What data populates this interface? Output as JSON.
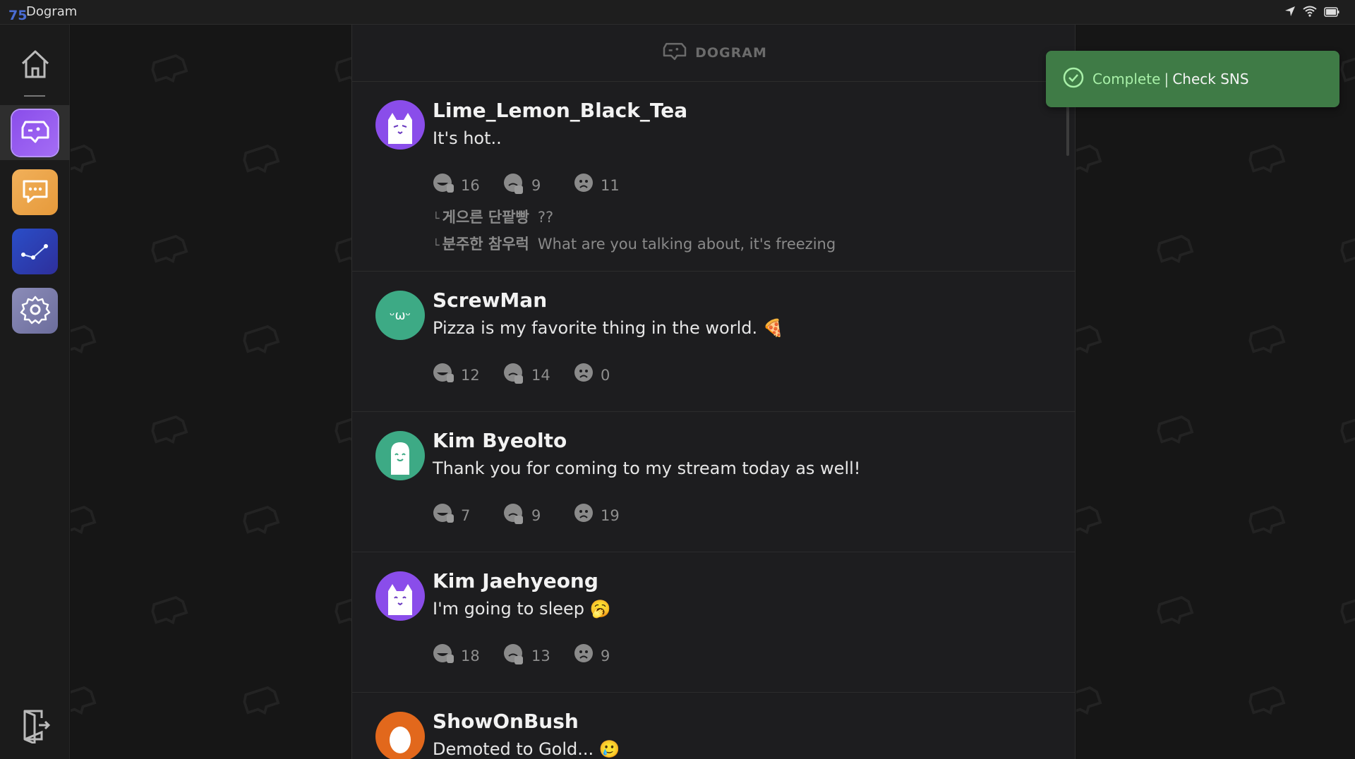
{
  "topbar": {
    "badge": "75",
    "app_title": "Dogram"
  },
  "header": {
    "brand": "DOGRAM"
  },
  "toast": {
    "status": "Complete",
    "separator": "|",
    "message": "Check SNS"
  },
  "posts": [
    {
      "author": "Lime_Lemon_Black_Tea",
      "text": "It's hot..",
      "avatar_color": "#8a4dea",
      "likes": "16",
      "dislikes": "9",
      "sad": "11",
      "comments": [
        {
          "author": "게으른 단팥빵",
          "text": "??"
        },
        {
          "author": "분주한 참우럭",
          "text": "What are you talking about, it's freezing"
        }
      ]
    },
    {
      "author": "ScrewMan",
      "text": "Pizza is my favorite thing in the world. 🍕",
      "avatar_color": "#3daa85",
      "avatar_face": "ᵕωᵕ",
      "likes": "12",
      "dislikes": "14",
      "sad": "0"
    },
    {
      "author": "Kim Byeolto",
      "text": "Thank you for coming to my stream today as well!",
      "avatar_color": "#3daa85",
      "likes": "7",
      "dislikes": "9",
      "sad": "19"
    },
    {
      "author": "Kim Jaehyeong",
      "text": "I'm going to sleep 🥱",
      "avatar_color": "#8a4dea",
      "likes": "18",
      "dislikes": "13",
      "sad": "9"
    },
    {
      "author": "ShowOnBush",
      "text": "Demoted to Gold... 🥲",
      "avatar_color": "#e2681c"
    }
  ],
  "colors": {
    "accent": "#8a4dea",
    "toast_bg": "#3f7b46",
    "feed_bg": "#1d1d1f"
  }
}
